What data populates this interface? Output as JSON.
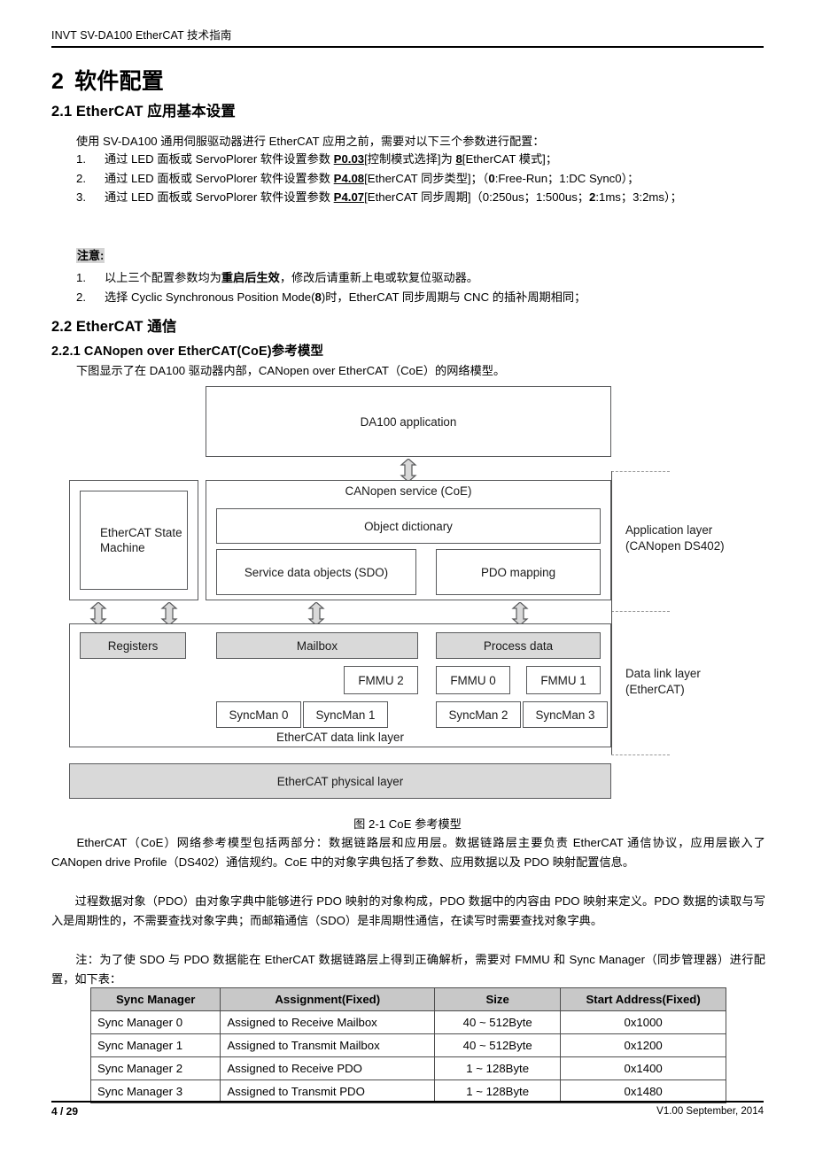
{
  "header": {
    "running_title": "INVT SV-DA100 EtherCAT 技术指南"
  },
  "headings": {
    "h1_num": "2",
    "h1_text": "软件配置",
    "h2_1": "2.1 EtherCAT 应用基本设置",
    "h2_2": "2.2 EtherCAT 通信",
    "h3_1": "2.2.1 CANopen over EtherCAT(CoE)参考模型"
  },
  "intro": "使用 SV-DA100 通用伺服驱动器进行 EtherCAT 应用之前，需要对以下三个参数进行配置：",
  "steps": [
    {
      "marker": "1.",
      "html": "通过 LED 面板或 ServoPlorer 软件设置参数 <b class=\"ul\">P0.03</b>[控制模式选择]为 <b class=\"ul\">8</b>[EtherCAT 模式]；"
    },
    {
      "marker": "2.",
      "html": "通过 LED 面板或 ServoPlorer 软件设置参数 <b class=\"ul\">P4.08</b>[EtherCAT 同步类型]；（<b class=\"nb\">0</b>:Free-Run；1:DC Sync0）；"
    },
    {
      "marker": "3.",
      "html": "通过 LED 面板或 ServoPlorer 软件设置参数 <b class=\"ul\">P4.07</b>[EtherCAT 同步周期]（0:250us；1:500us；<b class=\"nb\">2</b>:1ms；3:2ms）；"
    }
  ],
  "note": {
    "label": "注意:",
    "items": [
      {
        "marker": "1.",
        "html": "以上三个配置参数均为<b class=\"nb\">重启后生效</b>，修改后请重新上电或软复位驱动器。"
      },
      {
        "marker": "2.",
        "html": "选择 Cyclic Synchronous Position Mode(<b class=\"nb\">8</b>)时，EtherCAT 同步周期与 CNC 的插补周期相同；"
      }
    ]
  },
  "figure_intro": "下图显示了在 DA100 驱动器内部，CANopen over EtherCAT（CoE）的网络模型。",
  "diagram": {
    "application_box": "DA100 application",
    "canopen_service": "CANopen service (CoE)",
    "object_dictionary": "Object dictionary",
    "sdo": "Service data objects\n(SDO)",
    "pdo_mapping": "PDO mapping",
    "esm": "EtherCAT\nState\nMachine",
    "registers": "Registers",
    "mailbox": "Mailbox",
    "process_data": "Process data",
    "fmmu2": "FMMU 2",
    "fmmu0": "FMMU 0",
    "fmmu1": "FMMU 1",
    "syncman0": "SyncMan 0",
    "syncman1": "SyncMan 1",
    "syncman2": "SyncMan 2",
    "syncman3": "SyncMan 3",
    "dll_caption": "EtherCAT data link layer",
    "physical_layer": "EtherCAT physical layer",
    "right_label_app": "Application layer\n(CANopen DS402)",
    "right_label_dll": "Data link layer\n(EtherCAT)"
  },
  "figure_caption": "图 2-1 CoE 参考模型",
  "paragraphs": {
    "p1": "　　EtherCAT（CoE）网络参考模型包括两部分：数据链路层和应用层。数据链路层主要负责 EtherCAT 通信协议，应用层嵌入了 CANopen drive Profile（DS402）通信规约。CoE 中的对象字典包括了参数、应用数据以及 PDO 映射配置信息。",
    "p2": "　　过程数据对象（PDO）由对象字典中能够进行 PDO 映射的对象构成，PDO 数据中的内容由 PDO 映射来定义。PDO 数据的读取与写入是周期性的，不需要查找对象字典；而邮箱通信（SDO）是非周期性通信，在读写时需要查找对象字典。",
    "p3": "　　注：为了使 SDO 与 PDO 数据能在 EtherCAT 数据链路层上得到正确解析，需要对 FMMU 和 Sync Manager（同步管理器）进行配置，如下表："
  },
  "table": {
    "columns": [
      "Sync Manager",
      "Assignment(Fixed)",
      "Size",
      "Start Address(Fixed)"
    ],
    "rows": [
      [
        "Sync Manager 0",
        "Assigned to Receive Mailbox",
        "40 ~ 512Byte",
        "0x1000"
      ],
      [
        "Sync Manager 1",
        "Assigned to Transmit Mailbox",
        "40 ~ 512Byte",
        "0x1200"
      ],
      [
        "Sync Manager 2",
        "Assigned to Receive PDO",
        "1 ~ 128Byte",
        "0x1400"
      ],
      [
        "Sync Manager 3",
        "Assigned to Transmit PDO",
        "1 ~ 128Byte",
        "0x1480"
      ]
    ]
  },
  "footer": {
    "page": "4 / 29",
    "version": "V1.00 September, 2014"
  }
}
